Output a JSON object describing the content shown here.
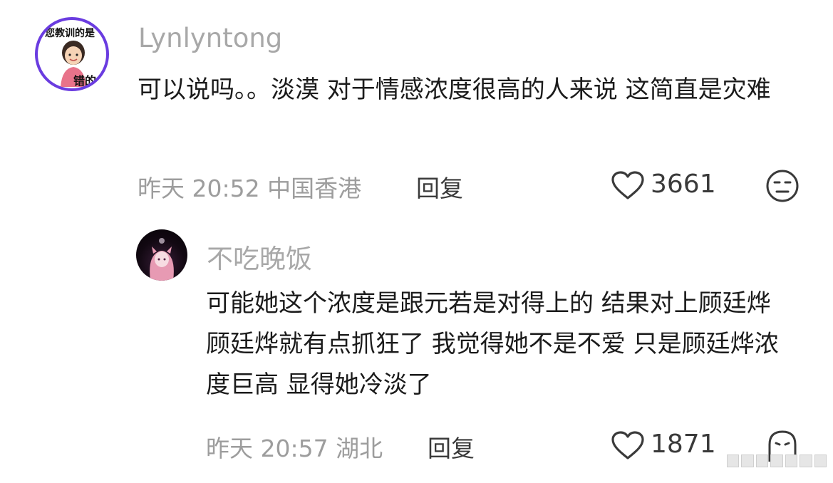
{
  "comments": [
    {
      "avatar_text_top": "您教训的是",
      "avatar_text_bottom": "错的",
      "username": "Lynlyntong",
      "content": "可以说吗。。淡漠 对于情感浓度很高的人来说 这简直是灾难",
      "time": "昨天 20:52",
      "location": "中国香港",
      "reply_label": "回复",
      "likes": "3661",
      "reaction_icon": "meh-face-icon"
    },
    {
      "username": "不吃晚饭",
      "content": "可能她这个浓度是跟元若是对得上的 结果对上顾廷烨 顾廷烨就有点抓狂了 我觉得她不是不爱 只是顾廷烨浓度巨高 显得她冷淡了",
      "time": "昨天 20:57",
      "location": "湖北",
      "reply_label": "回复",
      "likes": "1871",
      "reaction_icon": "ghost-face-icon"
    }
  ]
}
